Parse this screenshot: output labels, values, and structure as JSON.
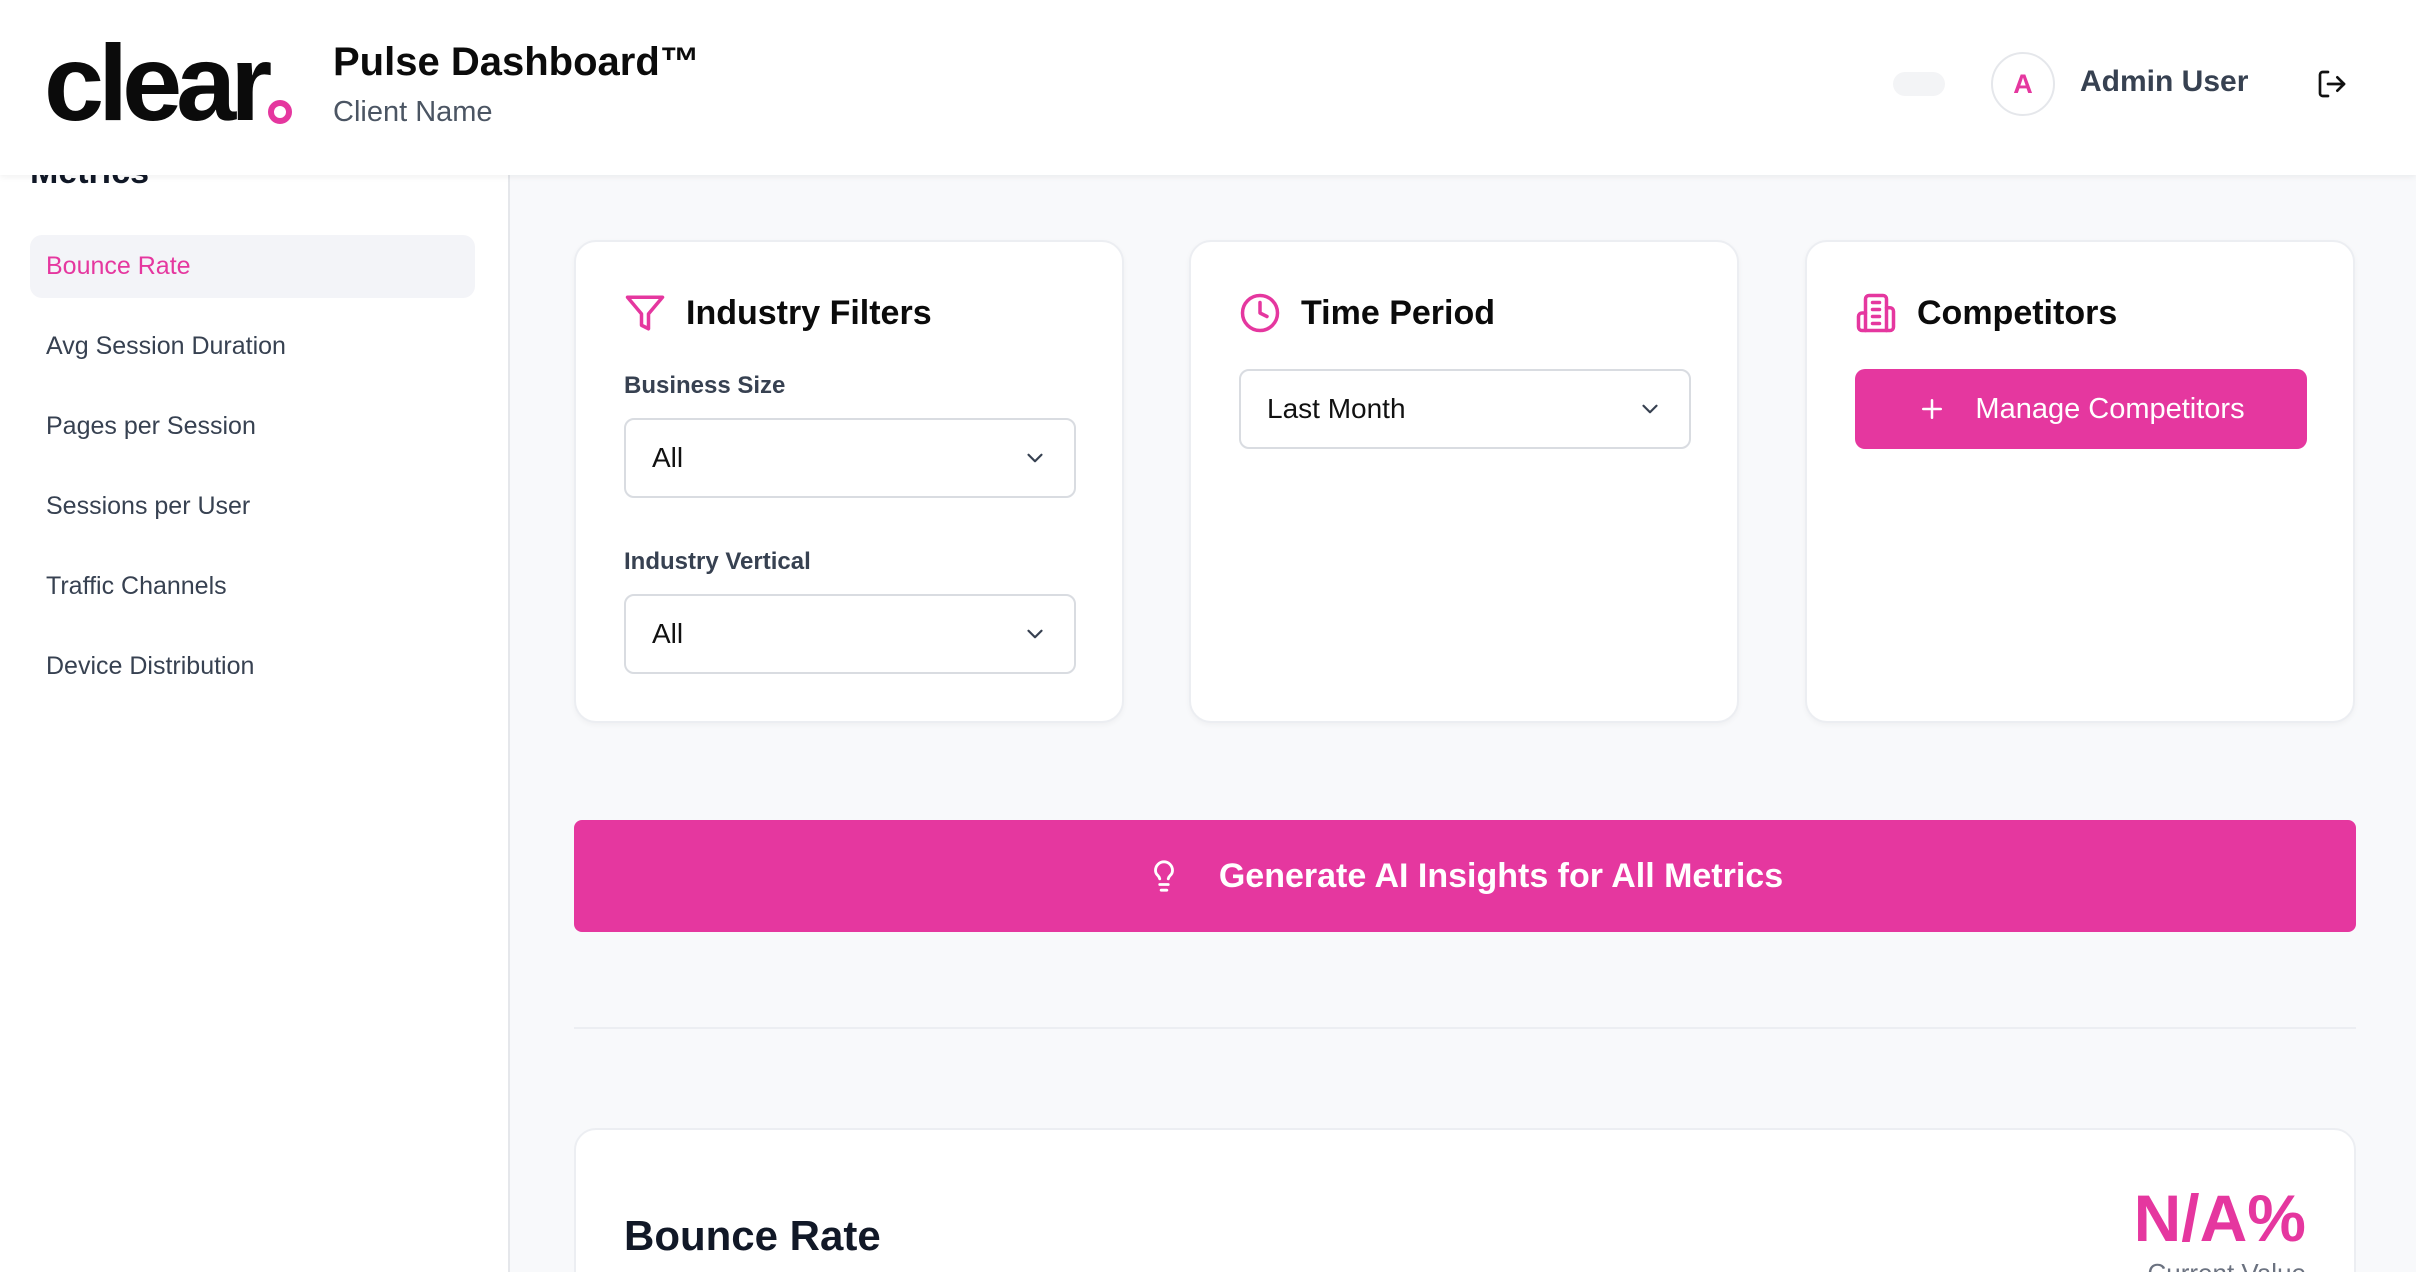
{
  "header": {
    "logo_text": "clear",
    "title": "Pulse Dashboard™",
    "subtitle": "Client Name",
    "user": {
      "initial": "A",
      "name": "Admin User"
    },
    "icons": {
      "logout": "logout-icon"
    }
  },
  "sidebar": {
    "heading": "Metrics",
    "items": [
      {
        "label": "Bounce Rate",
        "active": true
      },
      {
        "label": "Avg Session Duration",
        "active": false
      },
      {
        "label": "Pages per Session",
        "active": false
      },
      {
        "label": "Sessions per User",
        "active": false
      },
      {
        "label": "Traffic Channels",
        "active": false
      },
      {
        "label": "Device Distribution",
        "active": false
      }
    ]
  },
  "filters": {
    "industry": {
      "title": "Industry Filters",
      "icon": "filter-icon",
      "business_size_label": "Business Size",
      "business_size_value": "All",
      "vertical_label": "Industry Vertical",
      "vertical_value": "All"
    },
    "time": {
      "title": "Time Period",
      "icon": "clock-icon",
      "value": "Last Month"
    },
    "competitors": {
      "title": "Competitors",
      "icon": "building-icon",
      "button_label": "Manage Competitors"
    }
  },
  "actions": {
    "generate_label": "Generate AI Insights for All Metrics",
    "generate_icon": "lightbulb-icon"
  },
  "metric": {
    "title": "Bounce Rate",
    "value": "N/A%",
    "caption": "Current Value"
  },
  "colors": {
    "accent": "#e5379f",
    "text_dark": "#0b0b0b",
    "text_muted": "#374151",
    "background": "#f8f9fb",
    "sidebar_active_bg": "#f3f4f8"
  }
}
